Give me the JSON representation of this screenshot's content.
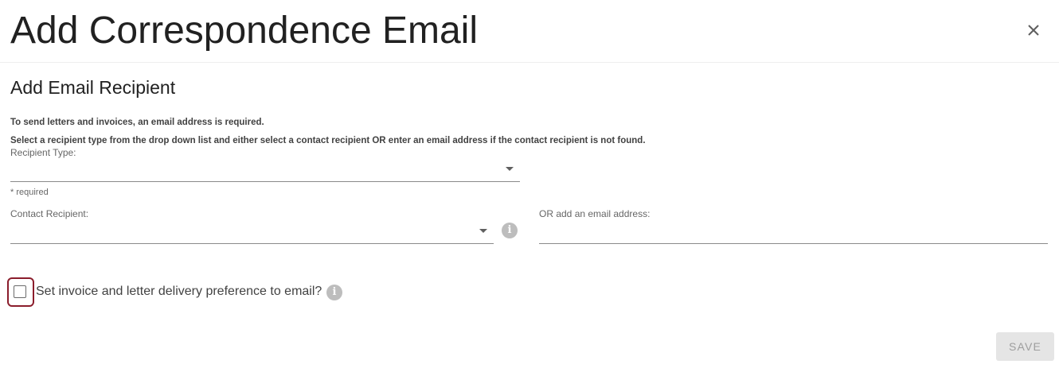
{
  "dialog": {
    "title": "Add Correspondence Email",
    "close_icon": "close-icon"
  },
  "section": {
    "title": "Add Email Recipient",
    "note_required": "To send letters and invoices, an email address is required.",
    "note_instructions": "Select a recipient type from the drop down list and either select a contact recipient OR enter an email address if the contact recipient is not found."
  },
  "recipient_type": {
    "label": "Recipient Type:",
    "value": "",
    "hint": "* required",
    "icon": "chevron-down-icon"
  },
  "contact_recipient": {
    "label": "Contact Recipient:",
    "value": "",
    "icon": "chevron-down-icon",
    "info_icon": "info-icon"
  },
  "email_address": {
    "label": "OR add an email address:",
    "value": ""
  },
  "delivery_preference": {
    "label": "Set invoice and letter delivery preference to email?",
    "checked": false,
    "info_icon": "info-icon"
  },
  "actions": {
    "save_label": "SAVE"
  },
  "colors": {
    "focus_outline": "#8b1d2c",
    "info_icon_bg": "#bdbdbd",
    "disabled_button_bg": "#e5e5e5",
    "disabled_button_text": "#9e9e9e"
  }
}
